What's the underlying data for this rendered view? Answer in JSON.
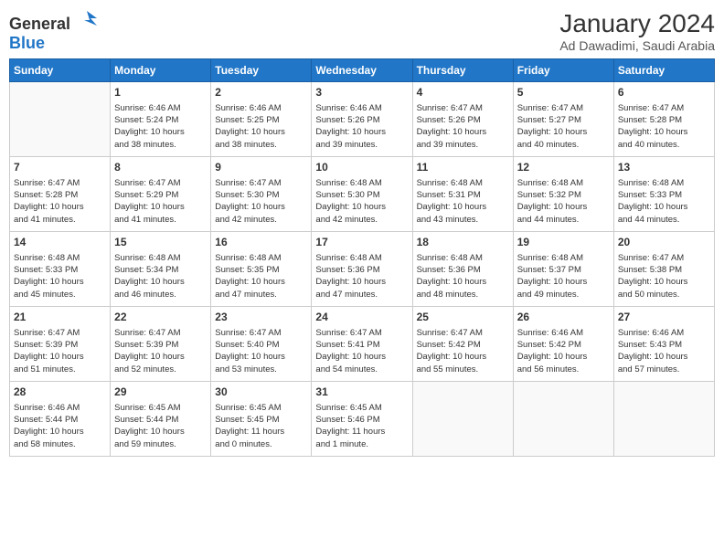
{
  "logo": {
    "general": "General",
    "blue": "Blue"
  },
  "header": {
    "month_year": "January 2024",
    "location": "Ad Dawadimi, Saudi Arabia"
  },
  "days_of_week": [
    "Sunday",
    "Monday",
    "Tuesday",
    "Wednesday",
    "Thursday",
    "Friday",
    "Saturday"
  ],
  "weeks": [
    [
      {
        "day": "",
        "info": ""
      },
      {
        "day": "1",
        "info": "Sunrise: 6:46 AM\nSunset: 5:24 PM\nDaylight: 10 hours\nand 38 minutes."
      },
      {
        "day": "2",
        "info": "Sunrise: 6:46 AM\nSunset: 5:25 PM\nDaylight: 10 hours\nand 38 minutes."
      },
      {
        "day": "3",
        "info": "Sunrise: 6:46 AM\nSunset: 5:26 PM\nDaylight: 10 hours\nand 39 minutes."
      },
      {
        "day": "4",
        "info": "Sunrise: 6:47 AM\nSunset: 5:26 PM\nDaylight: 10 hours\nand 39 minutes."
      },
      {
        "day": "5",
        "info": "Sunrise: 6:47 AM\nSunset: 5:27 PM\nDaylight: 10 hours\nand 40 minutes."
      },
      {
        "day": "6",
        "info": "Sunrise: 6:47 AM\nSunset: 5:28 PM\nDaylight: 10 hours\nand 40 minutes."
      }
    ],
    [
      {
        "day": "7",
        "info": "Sunrise: 6:47 AM\nSunset: 5:28 PM\nDaylight: 10 hours\nand 41 minutes."
      },
      {
        "day": "8",
        "info": "Sunrise: 6:47 AM\nSunset: 5:29 PM\nDaylight: 10 hours\nand 41 minutes."
      },
      {
        "day": "9",
        "info": "Sunrise: 6:47 AM\nSunset: 5:30 PM\nDaylight: 10 hours\nand 42 minutes."
      },
      {
        "day": "10",
        "info": "Sunrise: 6:48 AM\nSunset: 5:30 PM\nDaylight: 10 hours\nand 42 minutes."
      },
      {
        "day": "11",
        "info": "Sunrise: 6:48 AM\nSunset: 5:31 PM\nDaylight: 10 hours\nand 43 minutes."
      },
      {
        "day": "12",
        "info": "Sunrise: 6:48 AM\nSunset: 5:32 PM\nDaylight: 10 hours\nand 44 minutes."
      },
      {
        "day": "13",
        "info": "Sunrise: 6:48 AM\nSunset: 5:33 PM\nDaylight: 10 hours\nand 44 minutes."
      }
    ],
    [
      {
        "day": "14",
        "info": "Sunrise: 6:48 AM\nSunset: 5:33 PM\nDaylight: 10 hours\nand 45 minutes."
      },
      {
        "day": "15",
        "info": "Sunrise: 6:48 AM\nSunset: 5:34 PM\nDaylight: 10 hours\nand 46 minutes."
      },
      {
        "day": "16",
        "info": "Sunrise: 6:48 AM\nSunset: 5:35 PM\nDaylight: 10 hours\nand 47 minutes."
      },
      {
        "day": "17",
        "info": "Sunrise: 6:48 AM\nSunset: 5:36 PM\nDaylight: 10 hours\nand 47 minutes."
      },
      {
        "day": "18",
        "info": "Sunrise: 6:48 AM\nSunset: 5:36 PM\nDaylight: 10 hours\nand 48 minutes."
      },
      {
        "day": "19",
        "info": "Sunrise: 6:48 AM\nSunset: 5:37 PM\nDaylight: 10 hours\nand 49 minutes."
      },
      {
        "day": "20",
        "info": "Sunrise: 6:47 AM\nSunset: 5:38 PM\nDaylight: 10 hours\nand 50 minutes."
      }
    ],
    [
      {
        "day": "21",
        "info": "Sunrise: 6:47 AM\nSunset: 5:39 PM\nDaylight: 10 hours\nand 51 minutes."
      },
      {
        "day": "22",
        "info": "Sunrise: 6:47 AM\nSunset: 5:39 PM\nDaylight: 10 hours\nand 52 minutes."
      },
      {
        "day": "23",
        "info": "Sunrise: 6:47 AM\nSunset: 5:40 PM\nDaylight: 10 hours\nand 53 minutes."
      },
      {
        "day": "24",
        "info": "Sunrise: 6:47 AM\nSunset: 5:41 PM\nDaylight: 10 hours\nand 54 minutes."
      },
      {
        "day": "25",
        "info": "Sunrise: 6:47 AM\nSunset: 5:42 PM\nDaylight: 10 hours\nand 55 minutes."
      },
      {
        "day": "26",
        "info": "Sunrise: 6:46 AM\nSunset: 5:42 PM\nDaylight: 10 hours\nand 56 minutes."
      },
      {
        "day": "27",
        "info": "Sunrise: 6:46 AM\nSunset: 5:43 PM\nDaylight: 10 hours\nand 57 minutes."
      }
    ],
    [
      {
        "day": "28",
        "info": "Sunrise: 6:46 AM\nSunset: 5:44 PM\nDaylight: 10 hours\nand 58 minutes."
      },
      {
        "day": "29",
        "info": "Sunrise: 6:45 AM\nSunset: 5:44 PM\nDaylight: 10 hours\nand 59 minutes."
      },
      {
        "day": "30",
        "info": "Sunrise: 6:45 AM\nSunset: 5:45 PM\nDaylight: 11 hours\nand 0 minutes."
      },
      {
        "day": "31",
        "info": "Sunrise: 6:45 AM\nSunset: 5:46 PM\nDaylight: 11 hours\nand 1 minute."
      },
      {
        "day": "",
        "info": ""
      },
      {
        "day": "",
        "info": ""
      },
      {
        "day": "",
        "info": ""
      }
    ]
  ]
}
